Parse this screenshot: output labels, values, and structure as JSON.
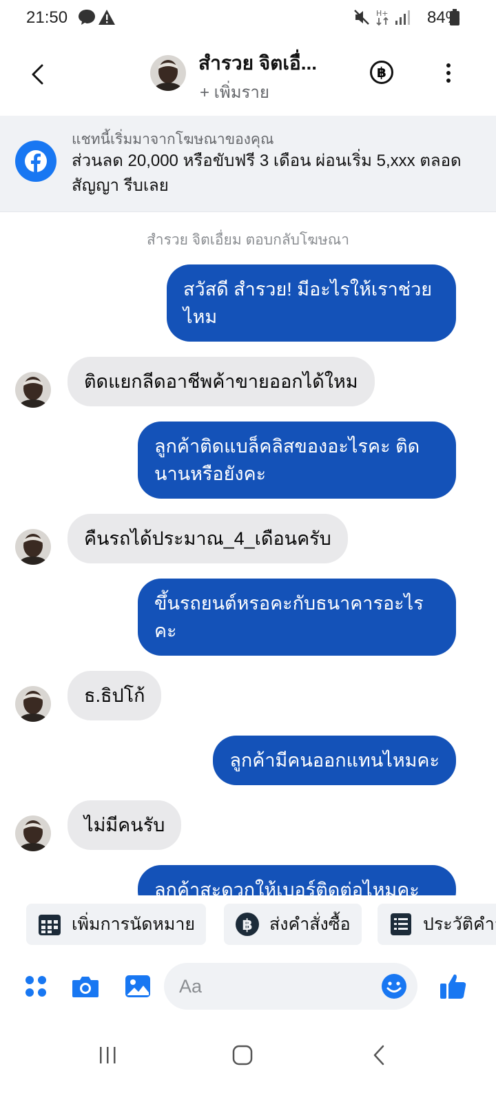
{
  "status_bar": {
    "time": "21:50",
    "battery": "84%"
  },
  "header": {
    "contact_name": "สำรวย จิตเอื่...",
    "subtitle": "+ เพิ่มราย",
    "baht_symbol": "฿"
  },
  "ad_banner": {
    "caption": "แชทนี้เริ่มมาจากโฆษณาของคุณ",
    "text": "ส่วนลด 20,000 หรือขับฟรี 3 เดือน ผ่อนเริ่ม 5,xxx ตลอดสัญญา รีบเลย"
  },
  "conversation": {
    "reply_note": "สำรวย จิตเอื่ยม ตอบกลับโฆษณา",
    "messages": [
      {
        "direction": "out",
        "text": "สวัสดี สำรวย! มีอะไรให้เราช่วยไหม"
      },
      {
        "direction": "in",
        "text": "ติดแยกลีดอาชีพค้าขายออกได้ใหม"
      },
      {
        "direction": "out",
        "text": "ลูกค้าติดแบล็คลิสของอะไรคะ ติดนานหรือยังคะ"
      },
      {
        "direction": "in",
        "text": "คืนรถได้ประมาณ_4_เดือนครับ"
      },
      {
        "direction": "out",
        "text": "ขึ้นรถยนต์หรอคะกับธนาคารอะไรคะ"
      },
      {
        "direction": "in",
        "text": "ธ.ธิปโก้"
      },
      {
        "direction": "out",
        "text": "ลูกค้ามีคนออกแทนไหมคะ"
      },
      {
        "direction": "in",
        "text": "ไม่มีคนรับ"
      },
      {
        "direction": "out",
        "text": "ลูกค้าสะดวกให้เบอร์ติดต่อไหมคะ"
      }
    ]
  },
  "quick_actions": [
    {
      "label": "เพิ่มการนัดหมาย",
      "icon": "calendar-icon"
    },
    {
      "label": "ส่งคำสั่งซื้อ",
      "icon": "baht-icon"
    },
    {
      "label": "ประวัติคำสั่งซื้อ",
      "icon": "receipt-icon"
    }
  ],
  "composer": {
    "placeholder": "Aa"
  },
  "colors": {
    "outgoing_bubble": "#1452b8",
    "incoming_bubble": "#e9e9eb",
    "accent": "#1877f2"
  }
}
